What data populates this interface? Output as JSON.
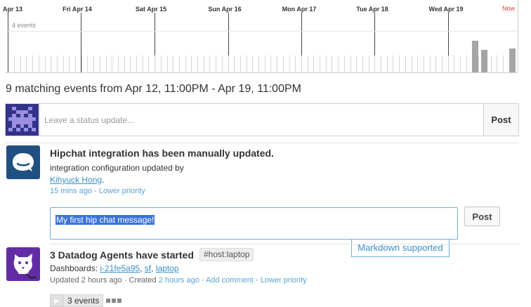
{
  "timeline": {
    "day_labels": [
      "Apr 13",
      "Fri Apr 14",
      "Sat Apr 15",
      "Sun Apr 16",
      "Mon Apr 17",
      "Tue Apr 18",
      "Wed Apr 19"
    ],
    "now_label": "Now",
    "event_count_label": "4 events",
    "now_color": "#e03c31",
    "bar_color": "#a5a5a5"
  },
  "header": {
    "matching_text": "9 matching events from Apr 12, 11:00PM - Apr 19, 11:00PM"
  },
  "status_update": {
    "placeholder": "Leave a status update...",
    "post_label": "Post"
  },
  "events": [
    {
      "icon": "hipchat-icon",
      "title": "Hipchat integration has been manually updated.",
      "body": "integration configuration updated by",
      "author_link": "Kihyuck Hong",
      "author_suffix": ".",
      "time": "15 mins ago",
      "separator": " · ",
      "priority_link": "Lower priority",
      "reply_value": "My first hip chat message!",
      "reply_post_label": "Post",
      "markdown_label": "Markdown supported"
    },
    {
      "icon": "datadog-icon",
      "title": "3 Datadog Agents have started",
      "tag": "#host:laptop",
      "dashboards_label": "Dashboards:",
      "dashboard_links": [
        "i-21fe5a95",
        "sf",
        "laptop"
      ],
      "comma": ",",
      "updated_text": "Updated 2 hours ago · Created",
      "created_link": "2 hours ago",
      "separator": " · ",
      "add_comment_link": "Add comment",
      "priority_link": "Lower priority",
      "expand_play": "▶",
      "expand_label": "3 events"
    }
  ],
  "colors": {
    "link": "#3a8fc9",
    "hipchat_bg": "#205081",
    "datadog_bg": "#632ca6",
    "selection": "#3b74d6"
  }
}
